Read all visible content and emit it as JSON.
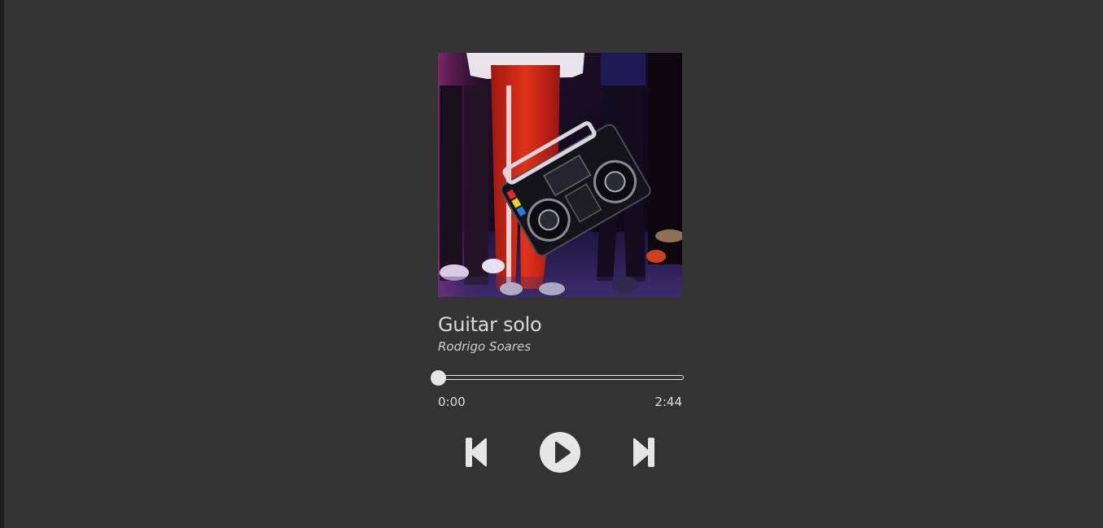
{
  "track": {
    "title": "Guitar solo",
    "artist": "Rodrigo Soares",
    "cover_image": "album-cover-boombox"
  },
  "progress": {
    "current_time": "0:00",
    "duration": "2:44",
    "fraction": 0
  },
  "controls": {
    "previous_icon": "skip-previous-icon",
    "play_icon": "play-circle-icon",
    "next_icon": "skip-next-icon"
  },
  "colors": {
    "background": "#333333",
    "text": "#d9d9d9",
    "controls": "#e6e6e6"
  }
}
